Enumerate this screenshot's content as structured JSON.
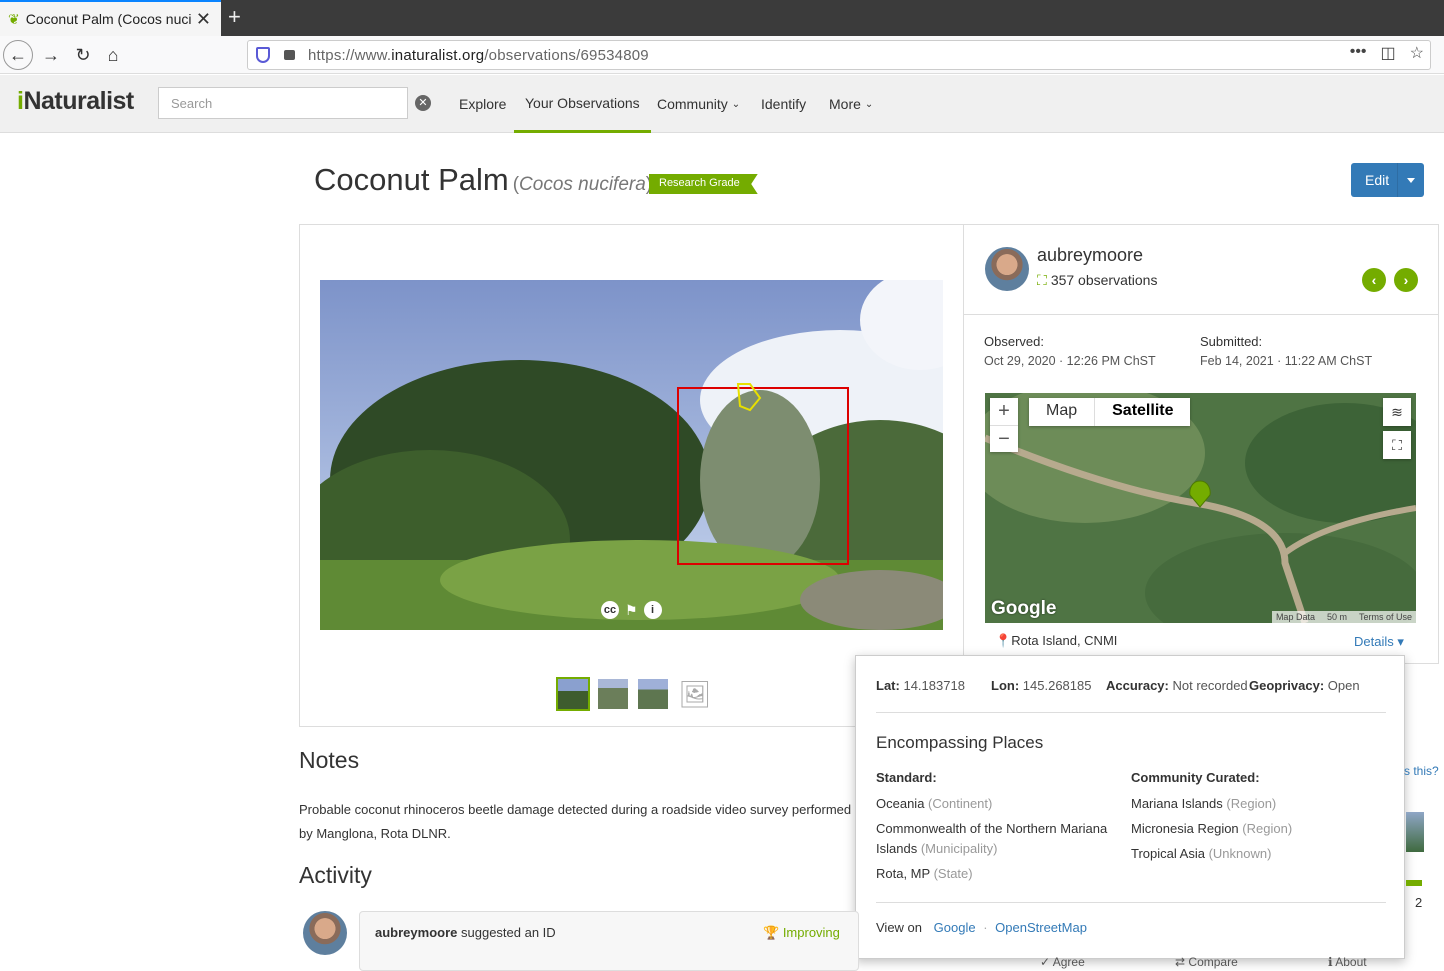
{
  "browser": {
    "tab_title": "Coconut Palm (Cocos nucifera)",
    "url_prefix": "https://www.",
    "url_domain": "inaturalist.org",
    "url_path": "/observations/69534809"
  },
  "header": {
    "logo": "iNaturalist",
    "search_placeholder": "Search",
    "menu": [
      "Explore",
      "Your Observations",
      "Community",
      "Identify",
      "More"
    ]
  },
  "observation": {
    "common_name": "Coconut Palm",
    "scientific_name": "Cocos nucifera",
    "quality_grade": "Research Grade",
    "edit_label": "Edit"
  },
  "observer": {
    "username": "aubreymoore",
    "observation_count": "357 observations"
  },
  "dates": {
    "observed_label": "Observed:",
    "observed_value": "Oct 29, 2020 · 12:26 PM ChST",
    "submitted_label": "Submitted:",
    "submitted_value": "Feb 14, 2021 · 11:22 AM ChST"
  },
  "map": {
    "map_label": "Map",
    "satellite_label": "Satellite",
    "selected": "Satellite",
    "logo": "Google",
    "map_data": "Map Data",
    "scale": "50 m",
    "terms": "Terms of Use",
    "place": "Rota Island, CNMI",
    "details_label": "Details"
  },
  "location_popup": {
    "lat_label": "Lat:",
    "lat": "14.183718",
    "lon_label": "Lon:",
    "lon": "145.268185",
    "accuracy_label": "Accuracy:",
    "accuracy": "Not recorded",
    "geoprivacy_label": "Geoprivacy:",
    "geoprivacy": "Open",
    "heading": "Encompassing Places",
    "standard_label": "Standard:",
    "standard_places": [
      {
        "name": "Oceania",
        "rank": "(Continent)"
      },
      {
        "name": "Commonwealth of the Northern Mariana Islands",
        "rank": "(Municipality)"
      },
      {
        "name": "Rota, MP",
        "rank": "(State)"
      }
    ],
    "community_label": "Community Curated:",
    "community_places": [
      {
        "name": "Mariana Islands",
        "rank": "(Region)"
      },
      {
        "name": "Micronesia Region",
        "rank": "(Region)"
      },
      {
        "name": "Tropical Asia",
        "rank": "(Unknown)"
      }
    ],
    "view_on_label": "View on",
    "view_on_google": "Google",
    "view_on_separator": "·",
    "view_on_osm": "OpenStreetMap"
  },
  "notes": {
    "heading": "Notes",
    "text": "Probable coconut rhinoceros beetle damage detected during a roadside video survey performed by Manglona, Rota DLNR."
  },
  "activity": {
    "heading": "Activity",
    "user": "aubreymoore",
    "action": "suggested an ID",
    "badge": "Improving",
    "side_link": "s this?",
    "side_count": "2",
    "btn_agree": "Agree",
    "btn_compare": "Compare",
    "btn_about": "About"
  }
}
